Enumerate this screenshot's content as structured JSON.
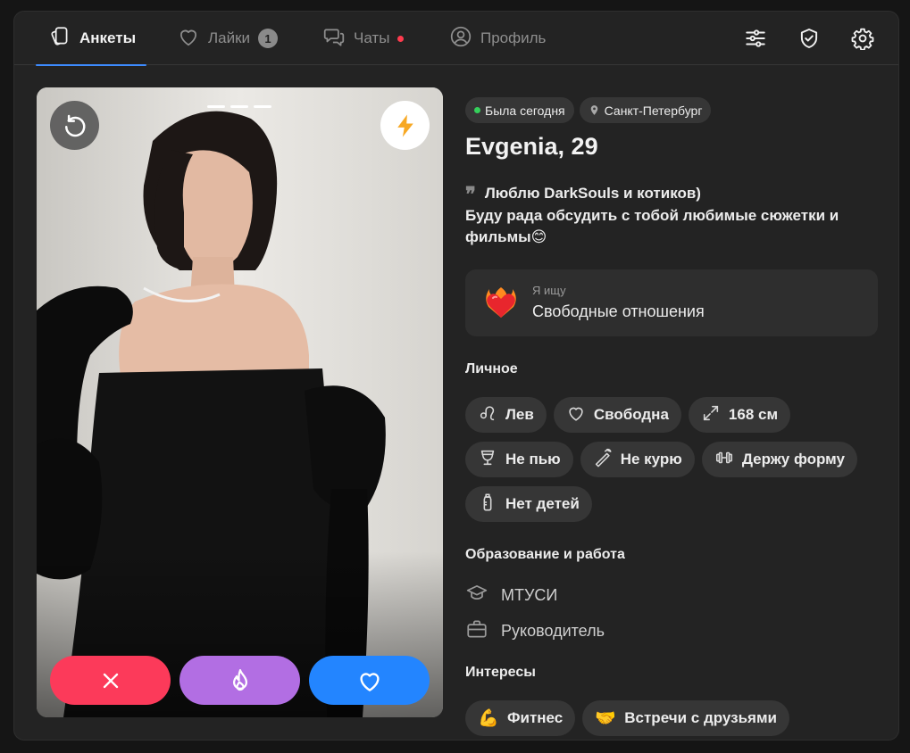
{
  "nav": {
    "tabs": [
      {
        "label": "Анкеты",
        "active": true,
        "icon": "cards-icon"
      },
      {
        "label": "Лайки",
        "badge": "1",
        "icon": "heart-icon"
      },
      {
        "label": "Чаты",
        "has_unread_dot": true,
        "icon": "chat-icon"
      },
      {
        "label": "Профиль",
        "icon": "user-icon"
      }
    ],
    "right_icons": [
      "filters-icon",
      "shield-check-icon",
      "gear-icon"
    ],
    "accent_color": "#3d8bff",
    "unread_dot_color": "#ff3b4e"
  },
  "photo_card": {
    "photo_count": 3,
    "current_photo": 1,
    "actions": {
      "dislike": {
        "icon": "close-icon",
        "color": "#fc3a5a"
      },
      "superlike": {
        "icon": "fire-icon",
        "color": "#b26ee3"
      },
      "like": {
        "icon": "heart-icon",
        "color": "#2385ff"
      }
    },
    "undo_icon": "undo-icon",
    "boost_icon": "lightning-icon",
    "boost_color": "#f7a823"
  },
  "profile": {
    "status": "Была сегодня",
    "status_color": "#35d05b",
    "city": "Санкт-Петербург",
    "name_age": "Evgenia, 29",
    "bio_line1": "Люблю DarkSouls и котиков)",
    "bio_line2": "Буду рада обсудить с тобой любимые сюжетки и фильмы",
    "bio_emoji": "😊",
    "looking_for": {
      "label": "Я ищу",
      "value": "Свободные отношения",
      "icon": "heart-on-fire-emoji"
    },
    "personal": {
      "title": "Личное",
      "items": [
        {
          "label": "Лев",
          "icon": "leo-icon"
        },
        {
          "label": "Свободна",
          "icon": "heart-icon"
        },
        {
          "label": "168 см",
          "icon": "expand-icon"
        },
        {
          "label": "Не пью",
          "icon": "glass-icon"
        },
        {
          "label": "Не курю",
          "icon": "no-smoking-icon"
        },
        {
          "label": "Держу форму",
          "icon": "dumbbell-icon"
        },
        {
          "label": "Нет детей",
          "icon": "baby-bottle-icon"
        }
      ]
    },
    "education_work": {
      "title": "Образование и работа",
      "education": "МТУСИ",
      "job": "Руководитель"
    },
    "interests": {
      "title": "Интересы",
      "items": [
        {
          "label": "Фитнес",
          "emoji": "💪"
        },
        {
          "label": "Встречи с друзьями",
          "emoji": "🤝"
        }
      ]
    }
  }
}
